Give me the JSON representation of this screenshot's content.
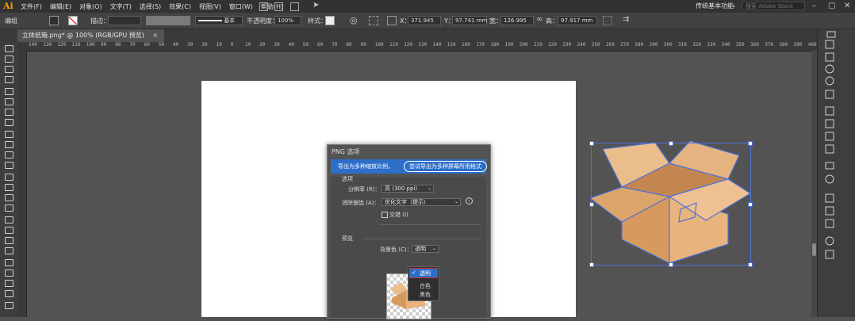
{
  "app": {
    "logo": "Ai"
  },
  "menubar": {
    "items": [
      "文件(F)",
      "编辑(E)",
      "对象(O)",
      "文字(T)",
      "选择(S)",
      "效果(C)",
      "视图(V)",
      "窗口(W)",
      "帮助(H)"
    ],
    "workspace": "传统基本功能",
    "search_placeholder": "搜索 Adobe Stock"
  },
  "control_bar": {
    "group_label": "编组",
    "stroke_label": "描边：",
    "brush_label": "基本",
    "opacity_label": "不透明度：",
    "opacity_value": "100%",
    "style_label": "样式：",
    "x_label": "X：",
    "x_value": "371.945",
    "y_label": "Y：",
    "y_value": "97.741 mm",
    "w_label": "宽：",
    "w_value": "126.995",
    "h_label": "高：",
    "h_value": "97.917 mm"
  },
  "tab": {
    "title": "立体纸箱.png* @ 100% (RGB/GPU 预览)",
    "close": "×"
  },
  "ruler_ticks": [
    "140",
    "130",
    "120",
    "110",
    "100",
    "90",
    "80",
    "70",
    "60",
    "50",
    "40",
    "30",
    "20",
    "10",
    "0",
    "10",
    "20",
    "30",
    "40",
    "50",
    "60",
    "70",
    "80",
    "90",
    "100",
    "110",
    "120",
    "130",
    "140",
    "150",
    "160",
    "170",
    "180",
    "190",
    "200",
    "210",
    "220",
    "230",
    "240",
    "250",
    "260",
    "270",
    "280",
    "290",
    "300",
    "310",
    "320",
    "330",
    "340",
    "350",
    "360",
    "370",
    "380",
    "390",
    "400"
  ],
  "dialog": {
    "title": "PNG 选项",
    "banner_text": "导出为多种缩放比例。",
    "banner_button": "尝试导出为多种屏幕所用格式",
    "section_options": "选项",
    "resolution_label": "分辨率 (R)：",
    "resolution_value": "高 (300 ppi)",
    "antialias_label": "消除锯齿 (A)：",
    "antialias_value": "优化文字（提示）",
    "interlace_label": "交错 (I)",
    "section_preview": "预览",
    "bg_label": "背景色 (C)：",
    "bg_value": "透明",
    "bg_options": [
      "透明",
      "白色",
      "黑色"
    ]
  },
  "colors": {
    "accent": "#2d6ec9",
    "selection": "#4f73d8",
    "box": "#e2ab73"
  }
}
